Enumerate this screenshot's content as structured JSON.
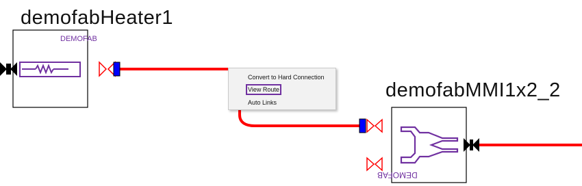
{
  "components": {
    "heater": {
      "title": "demofabHeater1",
      "tag": "DEMOFAB"
    },
    "mmi": {
      "title": "demofabMMI1x2_2",
      "tag": "DEMOFAB"
    }
  },
  "context_menu": {
    "items": [
      "Convert to Hard Connection",
      "View Route",
      "Auto Links"
    ],
    "highlighted": "View Route"
  },
  "colors": {
    "waveguide": "#ff0000",
    "component_symbol": "#7030a0",
    "port_connected": "#0000ff",
    "port_open": "#ff0000",
    "port_filled": "#000000"
  }
}
